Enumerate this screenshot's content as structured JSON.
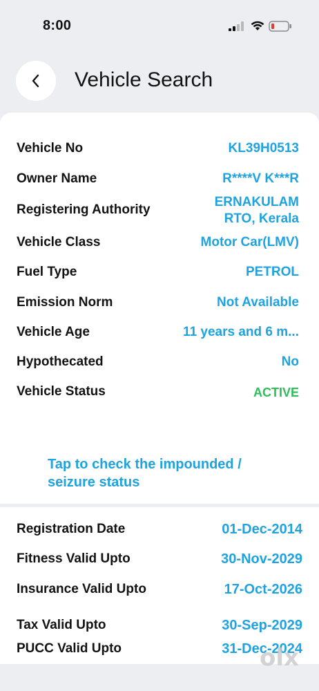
{
  "status": {
    "time": "8:00"
  },
  "header": {
    "title": "Vehicle Search"
  },
  "vehicle_details": [
    {
      "label": "Vehicle No",
      "value": "KL39H0513"
    },
    {
      "label": "Owner Name",
      "value": "R****V K***R"
    },
    {
      "label": "Registering Authority",
      "value_line1": "ERNAKULAM",
      "value_line2": "RTO, Kerala"
    },
    {
      "label": "Vehicle Class",
      "value": "Motor Car(LMV)"
    },
    {
      "label": "Fuel Type",
      "value": "PETROL"
    },
    {
      "label": "Emission Norm",
      "value": "Not Available"
    },
    {
      "label": "Vehicle Age",
      "value": "11 years and 6 m..."
    },
    {
      "label": "Hypothecated",
      "value": "No"
    },
    {
      "label": "Vehicle Status",
      "value": "ACTIVE"
    }
  ],
  "impound_link": {
    "line1": "Tap to check the impounded /",
    "line2": "seizure status"
  },
  "validity": [
    {
      "label": "Registration Date",
      "value": "01-Dec-2014"
    },
    {
      "label": "Fitness Valid Upto",
      "value": "30-Nov-2029"
    },
    {
      "label": "Insurance Valid Upto",
      "value": "17-Oct-2026"
    },
    {
      "label": "Tax Valid Upto",
      "value": "30-Sep-2029"
    },
    {
      "label": "PUCC Valid Upto",
      "value": "31-Dec-2024"
    }
  ],
  "watermark": "olx",
  "colors": {
    "accent": "#1fa3e0",
    "status_active": "#2dbd5a",
    "background": "#eceef2",
    "battery_low": "#e53935"
  }
}
